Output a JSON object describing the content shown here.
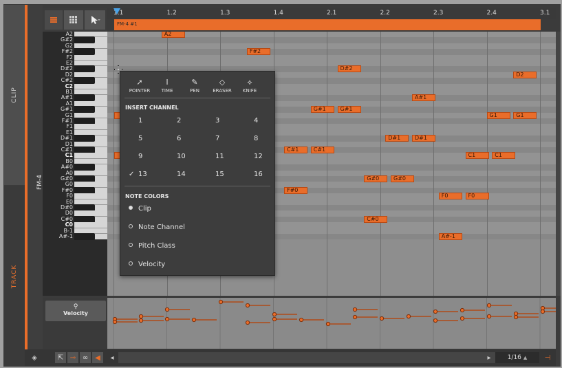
{
  "tabs": {
    "clip": "CLIP",
    "track": "TRACK"
  },
  "track": {
    "name": "FM-4"
  },
  "clip": {
    "name": "FM-4 #1"
  },
  "ruler": [
    "1.1",
    "1.2",
    "1.3",
    "1.4",
    "2.1",
    "2.2",
    "2.3",
    "2.4",
    "3.1"
  ],
  "keys": [
    "A2",
    "G#2",
    "G2",
    "F#2",
    "F2",
    "E2",
    "D#2",
    "D2",
    "C#2",
    "C2",
    "B1",
    "A#1",
    "A1",
    "G#1",
    "G1",
    "F#1",
    "F1",
    "E1",
    "D#1",
    "D1",
    "C#1",
    "C1",
    "B0",
    "A#0",
    "A0",
    "G#0",
    "G0",
    "F#0",
    "F0",
    "E0",
    "D#0",
    "D0",
    "C#0",
    "C0",
    "B-1",
    "A#-1"
  ],
  "notes": [
    {
      "label": "A2",
      "key": "A2",
      "beat": 0.9
    },
    {
      "label": "F#2",
      "key": "F#2",
      "beat": 2.5
    },
    {
      "label": "D#2",
      "key": "D#2",
      "beat": 4.2
    },
    {
      "label": "D2",
      "key": "D2",
      "beat": 7.5
    },
    {
      "label": "A#1",
      "key": "A#1",
      "beat": 5.6
    },
    {
      "label": "G#1",
      "key": "G#1",
      "beat": 3.7
    },
    {
      "label": "G#1",
      "key": "G#1",
      "beat": 4.2
    },
    {
      "label": "G1",
      "key": "G1",
      "beat": 7.0
    },
    {
      "label": "G1",
      "key": "G1",
      "beat": 7.5
    },
    {
      "label": "D#1",
      "key": "D#1",
      "beat": 5.1
    },
    {
      "label": "D#1",
      "key": "D#1",
      "beat": 5.6
    },
    {
      "label": "C#1",
      "key": "C#1",
      "beat": 3.2
    },
    {
      "label": "C#1",
      "key": "C#1",
      "beat": 3.7
    },
    {
      "label": "C1",
      "key": "C1",
      "beat": 6.6
    },
    {
      "label": "C1",
      "key": "C1",
      "beat": 7.1
    },
    {
      "label": "G#0",
      "key": "G#0",
      "beat": 4.7
    },
    {
      "label": "G#0",
      "key": "G#0",
      "beat": 5.2
    },
    {
      "label": "F#0",
      "key": "F#0",
      "beat": 3.2
    },
    {
      "label": "F0",
      "key": "F0",
      "beat": 6.1
    },
    {
      "label": "F0",
      "key": "F0",
      "beat": 6.6
    },
    {
      "label": "C#0",
      "key": "C#0",
      "beat": 4.7
    },
    {
      "label": "A#-1",
      "key": "A#-1",
      "beat": 6.1
    }
  ],
  "menu": {
    "tools": [
      {
        "icon": "pointer-icon",
        "label": "POINTER"
      },
      {
        "icon": "time-icon",
        "label": "TIME"
      },
      {
        "icon": "pen-icon",
        "label": "PEN"
      },
      {
        "icon": "eraser-icon",
        "label": "ERASER"
      },
      {
        "icon": "knife-icon",
        "label": "KNIFE"
      }
    ],
    "insert_channel_title": "INSERT CHANNEL",
    "channels": [
      "1",
      "2",
      "3",
      "4",
      "5",
      "6",
      "7",
      "8",
      "9",
      "10",
      "11",
      "12",
      "13",
      "14",
      "15",
      "16"
    ],
    "selected_channel": "13",
    "note_colors_title": "NOTE COLORS",
    "note_colors": [
      "Clip",
      "Note Channel",
      "Pitch Class",
      "Velocity"
    ],
    "selected_color": "Clip"
  },
  "velocity": {
    "label": "Velocity"
  },
  "bottom": {
    "zoom": "1/16"
  },
  "colors": {
    "accent": "#e96d2a"
  }
}
